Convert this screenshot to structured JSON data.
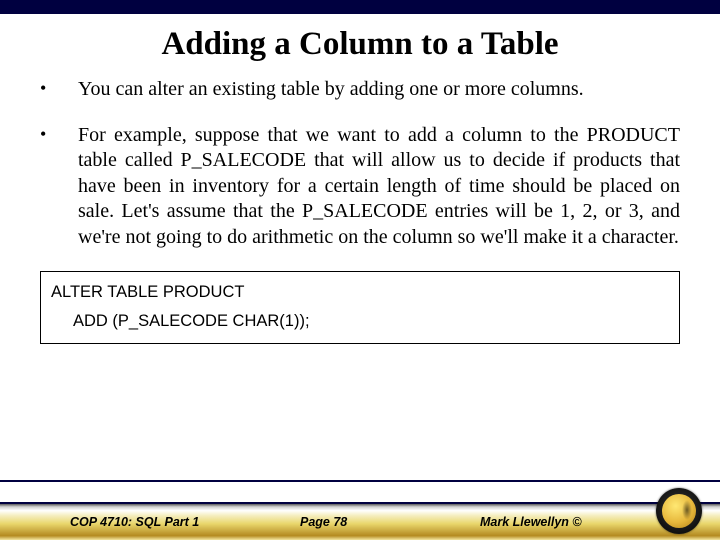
{
  "title": "Adding a Column to a Table",
  "bullets": [
    "You can alter an existing table by adding one or more columns.",
    "For example, suppose that we want to add a column to the PRODUCT table called P_SALECODE that will allow us to decide if products that have been in inventory for a certain length of time should be placed on sale.  Let's assume that the P_SALECODE entries will be 1, 2, or 3, and we're not going to do arithmetic on the column so we'll make it a character."
  ],
  "code": {
    "line1": "ALTER TABLE  PRODUCT",
    "line2": "ADD (P_SALECODE CHAR(1));"
  },
  "footer": {
    "course": "COP 4710: SQL Part 1",
    "page": "Page 78",
    "author": "Mark Llewellyn ©"
  }
}
